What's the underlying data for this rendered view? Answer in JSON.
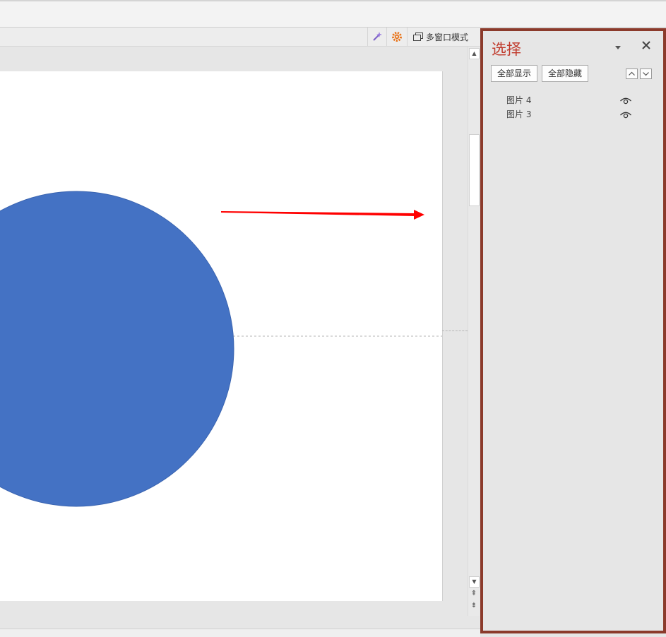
{
  "toolbar": {
    "multi_window_label": "多窗口模式"
  },
  "selection_pane": {
    "title": "选择",
    "show_all_label": "全部显示",
    "hide_all_label": "全部隐藏",
    "objects": [
      {
        "label": "图片 4"
      },
      {
        "label": "图片 3"
      }
    ]
  },
  "colors": {
    "panel_border": "#8b3a2b",
    "panel_title": "#c0392b",
    "circle_fill": "#4472c4",
    "arrow": "#ff0000"
  }
}
